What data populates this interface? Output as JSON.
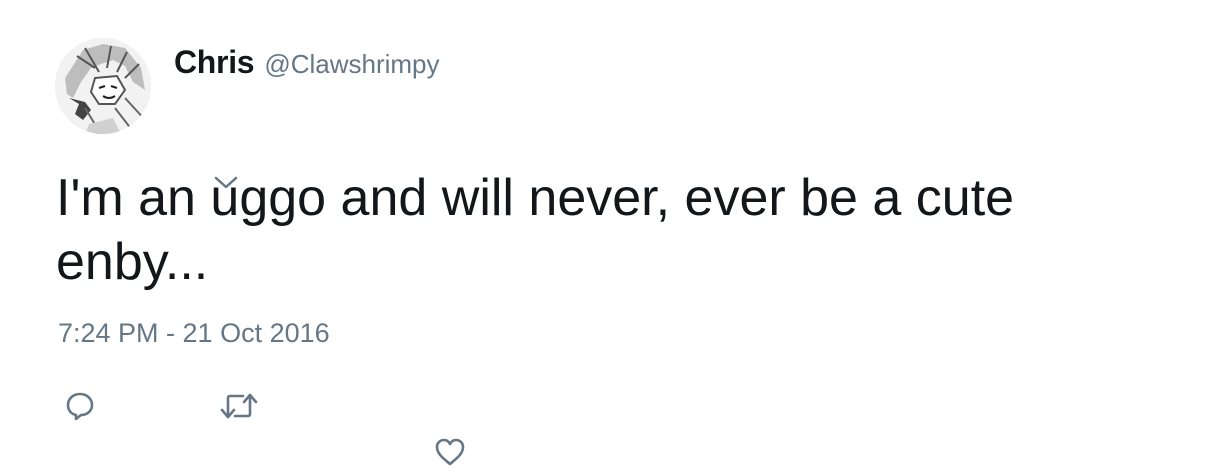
{
  "tweet": {
    "author": {
      "display_name": "Chris",
      "handle": "@Clawshrimpy"
    },
    "text": "I'm an uggo and will never, ever be a cute enby...",
    "timestamp": "7:24 PM - 21 Oct 2016"
  },
  "actions": {
    "reply_icon": "reply-icon",
    "retweet_icon": "retweet-icon",
    "like_icon": "heart-icon",
    "menu_icon": "chevron-down-icon"
  },
  "colors": {
    "text": "#14171a",
    "secondary": "#657786"
  }
}
